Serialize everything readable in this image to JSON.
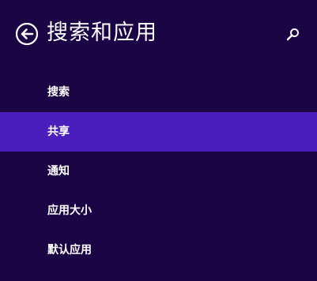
{
  "header": {
    "title": "搜索和应用",
    "back_icon": "back-arrow-circle-icon",
    "search_icon": "search-icon"
  },
  "menu": {
    "items": [
      {
        "label": "搜索",
        "selected": false
      },
      {
        "label": "共享",
        "selected": true
      },
      {
        "label": "通知",
        "selected": false
      },
      {
        "label": "应用大小",
        "selected": false
      },
      {
        "label": "默认应用",
        "selected": false
      }
    ]
  },
  "colors": {
    "background": "#1c0545",
    "selected_background": "#4a1ebd",
    "text": "#ffffff"
  }
}
